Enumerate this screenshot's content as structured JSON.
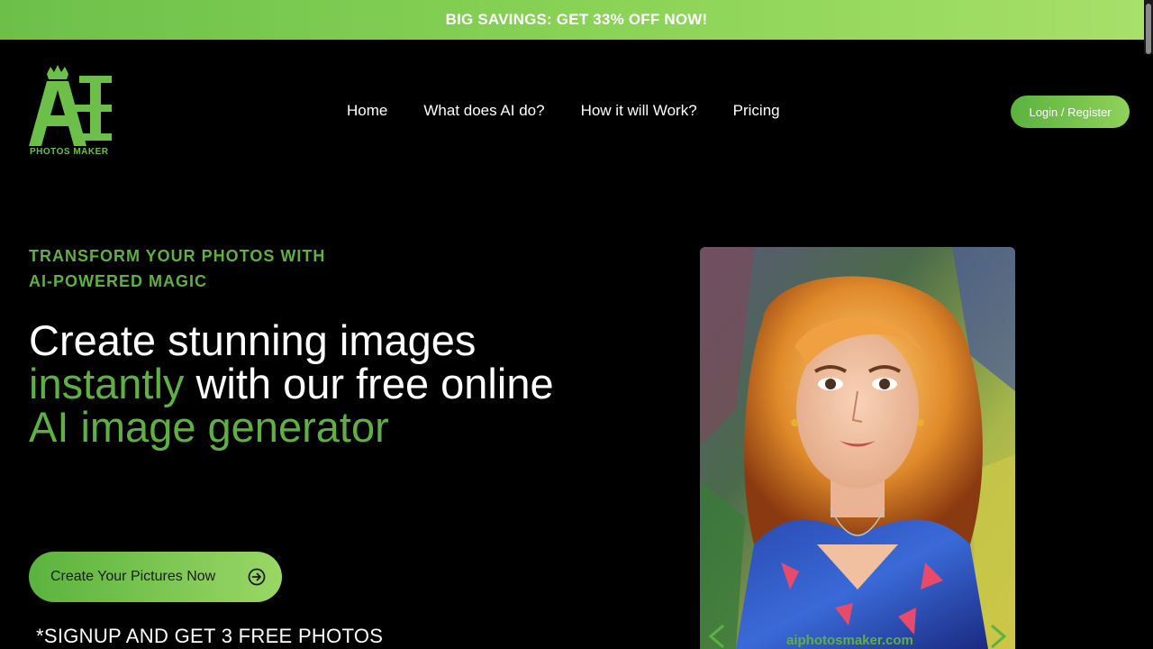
{
  "promo": {
    "text": "BIG SAVINGS: GET 33% OFF NOW!"
  },
  "logo": {
    "letters": "AI",
    "caption": "PHOTOS MAKER"
  },
  "nav": {
    "items": [
      {
        "label": "Home"
      },
      {
        "label": "What does AI do?"
      },
      {
        "label": "How it will Work?"
      },
      {
        "label": "Pricing"
      }
    ]
  },
  "auth": {
    "login_label": "Login / Register"
  },
  "hero": {
    "eyebrow_line1": "TRANSFORM YOUR PHOTOS WITH",
    "eyebrow_line2": "AI-POWERED MAGIC",
    "headline": {
      "part1": "Create stunning images ",
      "part2": "instantly",
      "part3": " with our free online ",
      "part4": "AI image generator"
    },
    "cta_label": "Create Your Pictures Now",
    "signup_note": "*SIGNUP AND GET 3 FREE PHOTOS",
    "image_watermark": "aiphotosmaker.com"
  },
  "colors": {
    "accent": "#5fb043",
    "background": "#000000",
    "promo_gradient_start": "#6cc04a",
    "promo_gradient_end": "#a8e06a"
  },
  "icons": {
    "logo": "crown-logo-icon",
    "cta": "arrow-circle-right-icon",
    "slider_prev": "chevron-left-icon",
    "slider_next": "chevron-right-icon"
  }
}
